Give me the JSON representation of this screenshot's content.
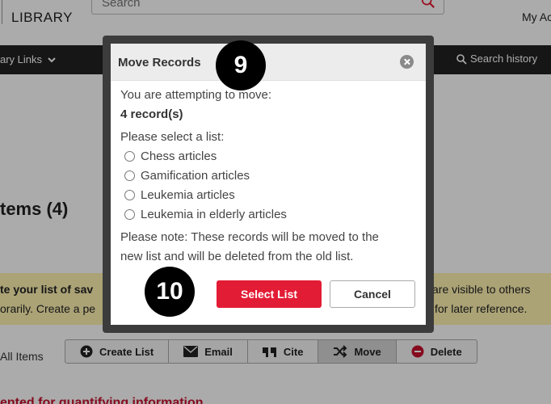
{
  "header": {
    "logo_text": "LIBRARY",
    "search_placeholder": "Search",
    "account_text": "My Ac"
  },
  "nav": {
    "left_label": "ary Links",
    "right_label": "Search history"
  },
  "page": {
    "items_title": "tems (4)",
    "notice_left_line1": "te your list of sav",
    "notice_left_line2": "orarily. Create a pe",
    "notice_right_line1": "are visible to others",
    "notice_right_line2": "for later reference.",
    "all_items_label": "All Items",
    "bottom_text": "ented for quantifying information"
  },
  "toolbar": {
    "buttons": [
      {
        "label": "Create List",
        "icon": "plus-circle-icon"
      },
      {
        "label": "Email",
        "icon": "envelope-icon"
      },
      {
        "label": "Cite",
        "icon": "quote-icon"
      },
      {
        "label": "Move",
        "icon": "shuffle-icon",
        "active": true
      },
      {
        "label": "Delete",
        "icon": "minus-circle-icon"
      }
    ]
  },
  "modal": {
    "title": "Move Records",
    "attempt_text": "You are attempting to move:",
    "record_count": "4 record(s)",
    "select_prompt": "Please select a list:",
    "lists": [
      {
        "label": "Chess articles"
      },
      {
        "label": "Gamification articles"
      },
      {
        "label": "Leukemia articles"
      },
      {
        "label": "Leukemia in elderly articles"
      }
    ],
    "note_line1": "Please note: These records will be moved to the",
    "note_line2": "new list and will be deleted from the old list.",
    "select_button": "Select List",
    "cancel_button": "Cancel"
  },
  "steps": {
    "step_a": "9",
    "step_b": "10"
  },
  "colors": {
    "primary_button": "#e31c35",
    "navbar": "#222222",
    "notice": "#fff3b0"
  }
}
